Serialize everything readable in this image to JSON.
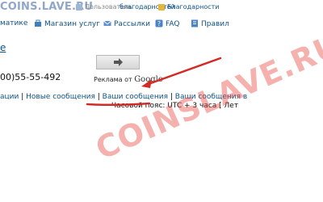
{
  "colors": {
    "link": "#105289",
    "annotation_red": "#d42a25",
    "watermark": "#e6463c"
  },
  "top_bar": {
    "site_logo": "COINS.LAVE.RU",
    "user_links": [
      {
        "label": "Пользователь",
        "icon": "user-icon"
      },
      {
        "label": "благодарностей",
        "icon": "thanks-icon"
      },
      {
        "label": "Благодарности",
        "icon": "thanks-icon"
      }
    ]
  },
  "nav": {
    "items": [
      {
        "label": "матике",
        "icon": ""
      },
      {
        "label": "Магазин услуг",
        "icon": "shop-icon"
      },
      {
        "label": "Рассылки",
        "icon": "mail-icon"
      },
      {
        "label": "FAQ",
        "icon": "faq-icon"
      },
      {
        "label": "Правил",
        "icon": "rules-icon"
      }
    ]
  },
  "left_link": "e",
  "phone": "00)55-55-492",
  "ad": {
    "arrow_icon": "arrow-right-icon",
    "caption": "Реклама от",
    "brand": "Google"
  },
  "links_row": {
    "items": [
      {
        "label": "ации"
      },
      {
        "label": "Новые сообщения"
      },
      {
        "label": "Ваши сообщения"
      },
      {
        "label": "Ваши сообщения в"
      }
    ]
  },
  "timezone": "Часовой пояс: UTC + 3 часа [ Лет",
  "watermark": "COINSLAVE.RU"
}
